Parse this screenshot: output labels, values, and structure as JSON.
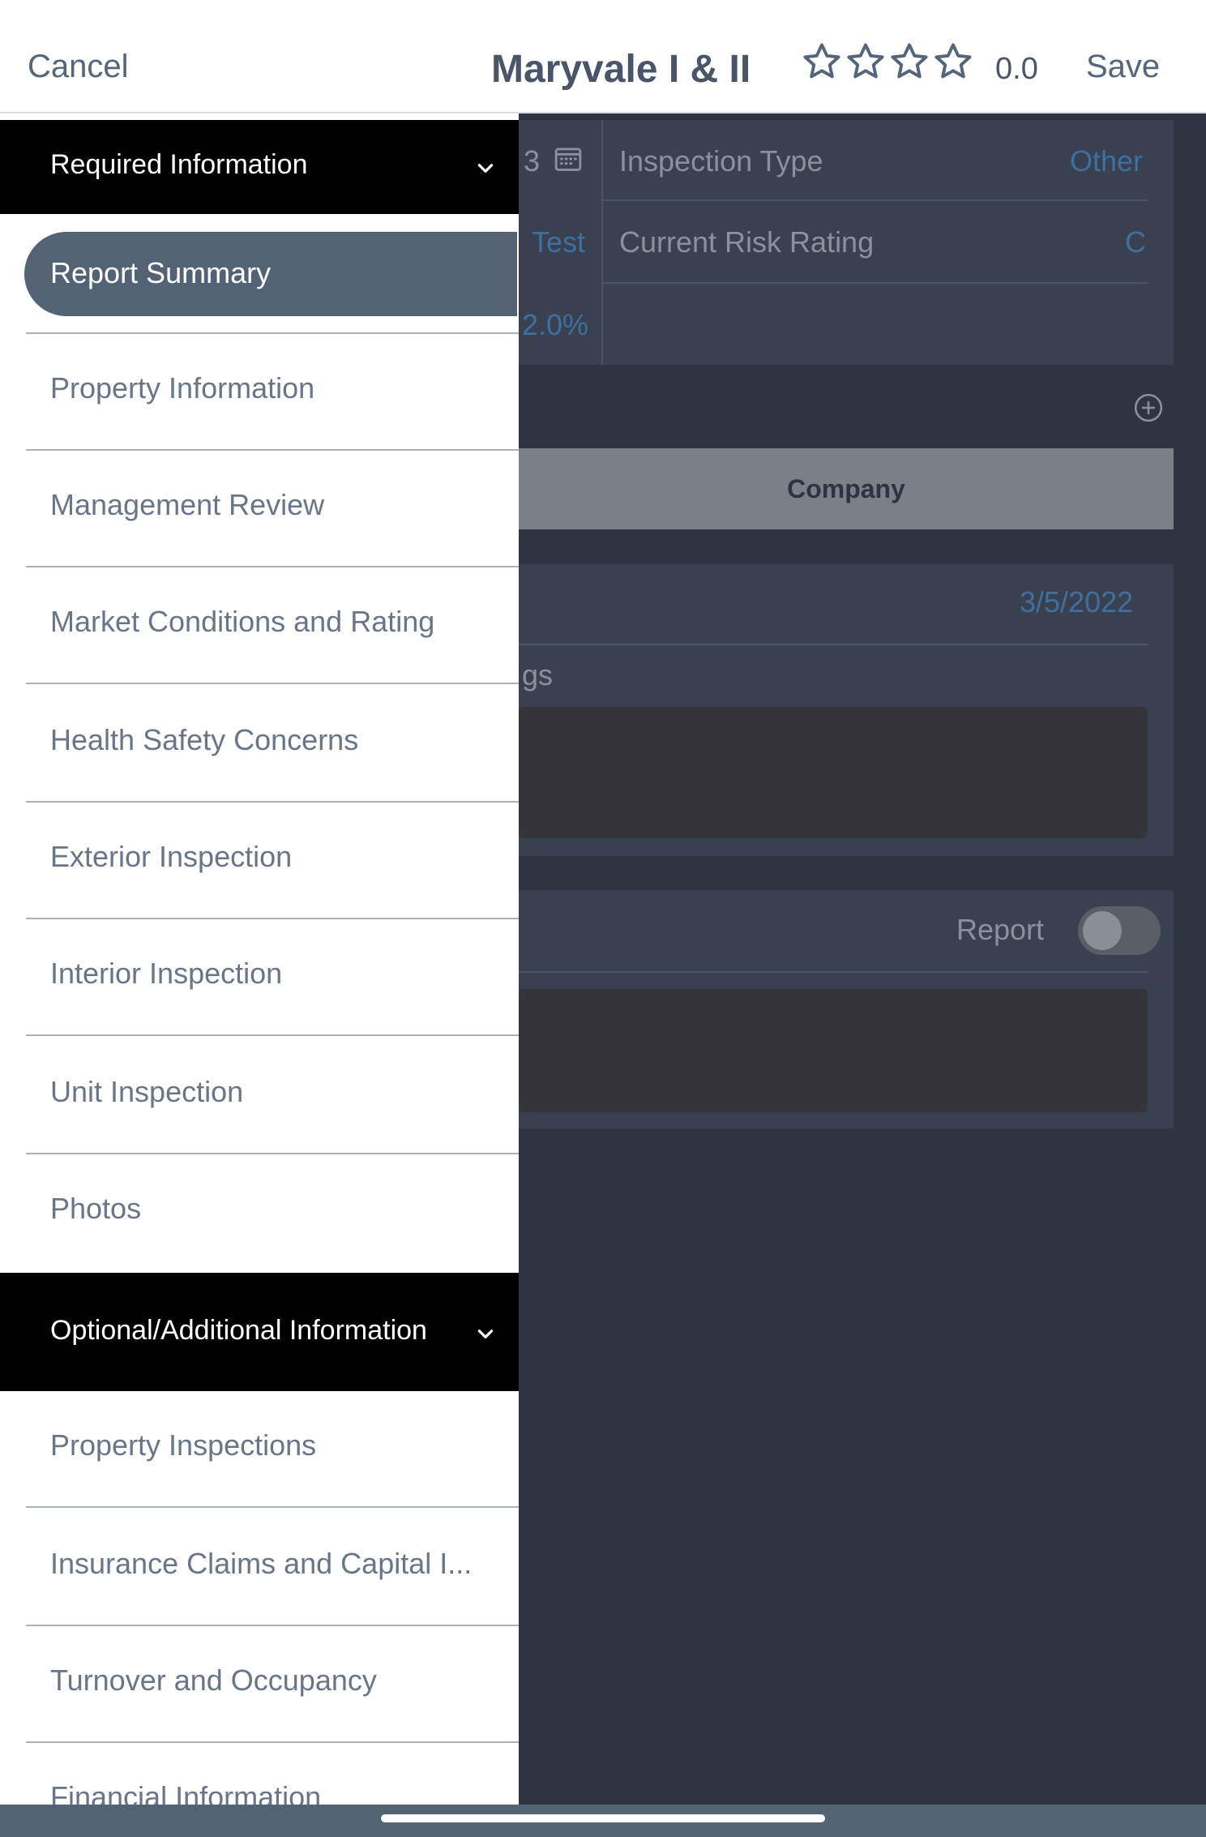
{
  "header": {
    "cancel_label": "Cancel",
    "title": "Maryvale I & II",
    "stars": 0,
    "star_max": 5,
    "rating_value": "0.0",
    "save_label": "Save"
  },
  "background": {
    "field_date_partial": "3",
    "inspection_type_label": "Inspection Type",
    "inspection_type_value": "Other",
    "test_partial": "Test",
    "current_risk_label": "Current Risk Rating",
    "current_risk_value": "C",
    "percent_partial": "2.0%",
    "company_label": "Company",
    "date_value": "3/5/2022",
    "findings_partial": "gs",
    "report_label": "Report",
    "report_toggle": false
  },
  "drawer": {
    "required_header": "Required Information",
    "required_items": [
      {
        "label": "Report Summary",
        "active": true
      },
      {
        "label": "Property Information"
      },
      {
        "label": "Management Review"
      },
      {
        "label": "Market Conditions and Rating"
      },
      {
        "label": "Health Safety Concerns"
      },
      {
        "label": "Exterior Inspection"
      },
      {
        "label": "Interior Inspection"
      },
      {
        "label": "Unit Inspection"
      },
      {
        "label": "Photos"
      }
    ],
    "optional_header": "Optional/Additional Information",
    "optional_items": [
      {
        "label": "Property Inspections"
      },
      {
        "label": "Insurance Claims and Capital I..."
      },
      {
        "label": "Turnover and Occupancy"
      },
      {
        "label": "Financial Information"
      }
    ]
  },
  "colors": {
    "accent_active": "#546275",
    "link_blue": "#3f6f9e",
    "section_header_bg": "#000000"
  },
  "icons": [
    "star-icon",
    "calendar-icon",
    "add-circle-icon",
    "chevron-down-icon"
  ]
}
